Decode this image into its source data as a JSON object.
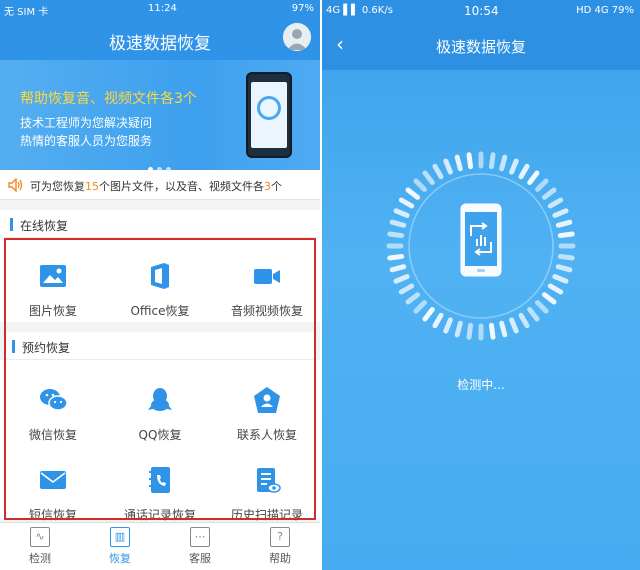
{
  "left": {
    "status": {
      "carrier": "无 SIM 卡",
      "time": "11:24",
      "battery": "97%"
    },
    "header": {
      "title": "极速数据恢复"
    },
    "banner": {
      "headline": "帮助恢复音、视频文件各3个",
      "line1": "技术工程师为您解决疑问",
      "line2": "热情的客服人员为您服务"
    },
    "notice": {
      "prefix": "可为您恢复",
      "count1": "15",
      "middle": "个图片文件，以及音、视频文件各",
      "count2": "3",
      "suffix": "个"
    },
    "online": {
      "title": "在线恢复",
      "items": [
        {
          "label": "图片恢复",
          "icon": "image-icon"
        },
        {
          "label": "Office恢复",
          "icon": "office-icon"
        },
        {
          "label": "音频视频恢复",
          "icon": "video-camera-icon"
        }
      ]
    },
    "reserve": {
      "title": "预约恢复",
      "items": [
        {
          "label": "微信恢复",
          "icon": "wechat-icon"
        },
        {
          "label": "QQ恢复",
          "icon": "qq-icon"
        },
        {
          "label": "联系人恢复",
          "icon": "contact-icon"
        },
        {
          "label": "短信恢复",
          "icon": "sms-icon"
        },
        {
          "label": "通话记录恢复",
          "icon": "call-log-icon"
        },
        {
          "label": "历史扫描记录",
          "icon": "scan-history-icon"
        }
      ]
    },
    "tabs": [
      {
        "label": "检测",
        "icon": "detect-icon"
      },
      {
        "label": "恢复",
        "icon": "recover-icon"
      },
      {
        "label": "客服",
        "icon": "service-icon"
      },
      {
        "label": "帮助",
        "icon": "help-icon"
      }
    ],
    "active_tab": "恢复"
  },
  "right": {
    "status": {
      "network": "4G",
      "speed": "0.6K/s",
      "time": "10:54",
      "battery": "HD 4G 79%"
    },
    "header": {
      "title": "极速数据恢复",
      "back": "‹"
    },
    "status_text": "检测中..."
  },
  "colors": {
    "primary": "#2f93e8",
    "accent": "#f08a1e",
    "highlight": "#ffd93b",
    "frame": "#d22b2b"
  }
}
